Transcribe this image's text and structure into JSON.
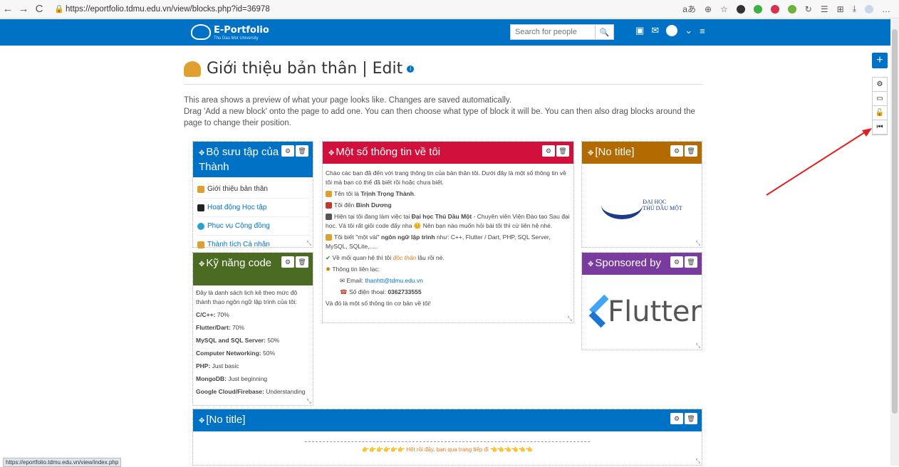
{
  "browser": {
    "url": "https://eportfolio.tdmu.edu.vn/view/blocks.php?id=36978",
    "status_url": "https://eportfolio.tdmu.edu.vn/view/index.php",
    "back": "←",
    "forward": "→",
    "reload": "C"
  },
  "header": {
    "logo_text": "E-Portfolio",
    "logo_sub": "Thu Dau Mot University",
    "search_placeholder": "Search for people",
    "search_icon": "search-icon",
    "icons": [
      "flag-icon",
      "mail-icon",
      "avatar-icon",
      "menu-icon"
    ]
  },
  "page": {
    "title": "Giới thiệu bản thân | Edit",
    "intro_line1": "This area shows a preview of what your page looks like. Changes are saved automatically.",
    "intro_line2": "Drag 'Add a new block' onto the page to add one. You can then choose what type of block it will be. You can then also drag blocks around the page to change their position."
  },
  "blocks": {
    "collection": {
      "title": "Bộ sưu tập của Thành",
      "color": "#0072c6",
      "items": [
        "Giới thiệu bản thân",
        "Hoạt động Học tập",
        "Phục vụ Cộng đồng",
        "Thành tích Cá nhân"
      ]
    },
    "skills": {
      "title": "Kỹ năng code",
      "color": "#4a6b21",
      "intro": "Đây là danh sách lịch kê theo mức độ thành thạo ngôn ngữ lập trình của tôi:",
      "rows": [
        {
          "name": "C/C++:",
          "value": " 70%"
        },
        {
          "name": "Flutter/Dart:",
          "value": " 70%"
        },
        {
          "name": "MySQL and SQL Server:",
          "value": " 50%"
        },
        {
          "name": "Computer Networking:",
          "value": " 50%"
        },
        {
          "name": "PHP:",
          "value": " Just basic"
        },
        {
          "name": "MongoDB:",
          "value": " Just beginning"
        },
        {
          "name": "Google Cloud/Firebase:",
          "value": " Understanding"
        }
      ]
    },
    "info": {
      "title": "Một số thông tin về tôi",
      "color": "#d1113c",
      "p1": "Chào các bạn đã đến với trang thông tin của bản thân tôi. Dưới đây là một số thông tin về tôi mà bạn có thể đã biết rồi hoặc chưa biết.",
      "name_pre": "Tên tôi là ",
      "name": "Trịnh Trọng Thành",
      "from_pre": "Tôi đến ",
      "from": "Bình Dương",
      "work_pre": "Hiện tại tôi đang làm việc tại ",
      "work_place": "Đại học Thủ Dầu Một",
      "work_post": " - Chuyên viên Viện Đào tạo Sau đại học. Và tôi rất giỏi code đấy nha 😊 Nên bạn nào muốn hỏi bài tôi thì cứ liên hệ nhé.",
      "lang_pre": "Tôi biết \"một vài\" ",
      "lang_bold": "ngôn ngữ lập trình",
      "lang_post": " như: C++, Flutter / Dart, PHP, SQL Server, MySQL, SQLite,.....",
      "rel_pre": "Về mối quan hệ thì tôi ",
      "rel_hl": "độc thân",
      "rel_post": " lâu rồi nè.",
      "contact": "Thông tin liên lạc:",
      "email_label": "Email: ",
      "email": "thanhtt@tdmu.edu.vn",
      "phone_label": "Số điện thoại: ",
      "phone": "0362733555",
      "end": "Và đó là một số thông tin cơ bản về tôi!"
    },
    "notitle1": {
      "title": "[No title]",
      "color": "#b36b00",
      "uni_line1": "ĐẠI HỌC",
      "uni_line2": "THỦ DẦU MỘT"
    },
    "sponsored": {
      "title": "Sponsored by",
      "color": "#7a3b9e",
      "logo_text": "Flutter"
    },
    "notitle2": {
      "title": "[No title]",
      "color": "#0072c6",
      "footer_pre": "👉👉👉👉👉👉 ",
      "footer_hl": "Hết rồi đây, bạn qua trang tiếp đi",
      "footer_post": " 👈👈👈👈👈👈"
    }
  },
  "toolbar": {
    "add": "+"
  },
  "controls": {
    "settings": "⚙",
    "delete": "🗑",
    "move": "✥"
  }
}
